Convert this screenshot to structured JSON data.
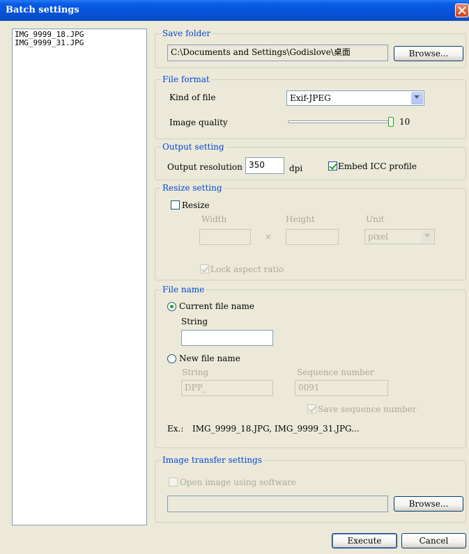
{
  "window": {
    "title": "Batch settings"
  },
  "file_list": [
    "IMG_9999_18.JPG",
    "IMG_9999_31.JPG"
  ],
  "save_folder": {
    "legend": "Save folder",
    "path": "C:\\Documents and Settings\\Godislove\\桌面",
    "browse_label": "Browse..."
  },
  "file_format": {
    "legend": "File format",
    "kind_label": "Kind of file",
    "kind_value": "Exif-JPEG",
    "quality_label": "Image quality",
    "quality_value": "10"
  },
  "output": {
    "legend": "Output setting",
    "resolution_label": "Output resolution",
    "resolution_value": "350",
    "unit": "dpi",
    "embed_label": "Embed ICC profile"
  },
  "resize": {
    "legend": "Resize setting",
    "resize_label": "Resize",
    "width_label": "Width",
    "height_label": "Height",
    "unit_label": "Unit",
    "times": "×",
    "unit_value": "pixel",
    "lock_label": "Lock aspect ratio"
  },
  "file_name": {
    "legend": "File name",
    "current_label": "Current file name",
    "string_label": "String",
    "new_label": "New file name",
    "new_string_label": "String",
    "new_string_value": "DPP_",
    "sequence_label": "Sequence number",
    "sequence_value": "0091",
    "save_sequence_label": "Save sequence number",
    "example_label": "Ex.:",
    "example_value": "IMG_9999_18.JPG, IMG_9999_31.JPG..."
  },
  "transfer": {
    "legend": "Image transfer settings",
    "open_label": "Open image using software",
    "browse_label": "Browse..."
  },
  "buttons": {
    "execute": "Execute",
    "cancel": "Cancel"
  }
}
